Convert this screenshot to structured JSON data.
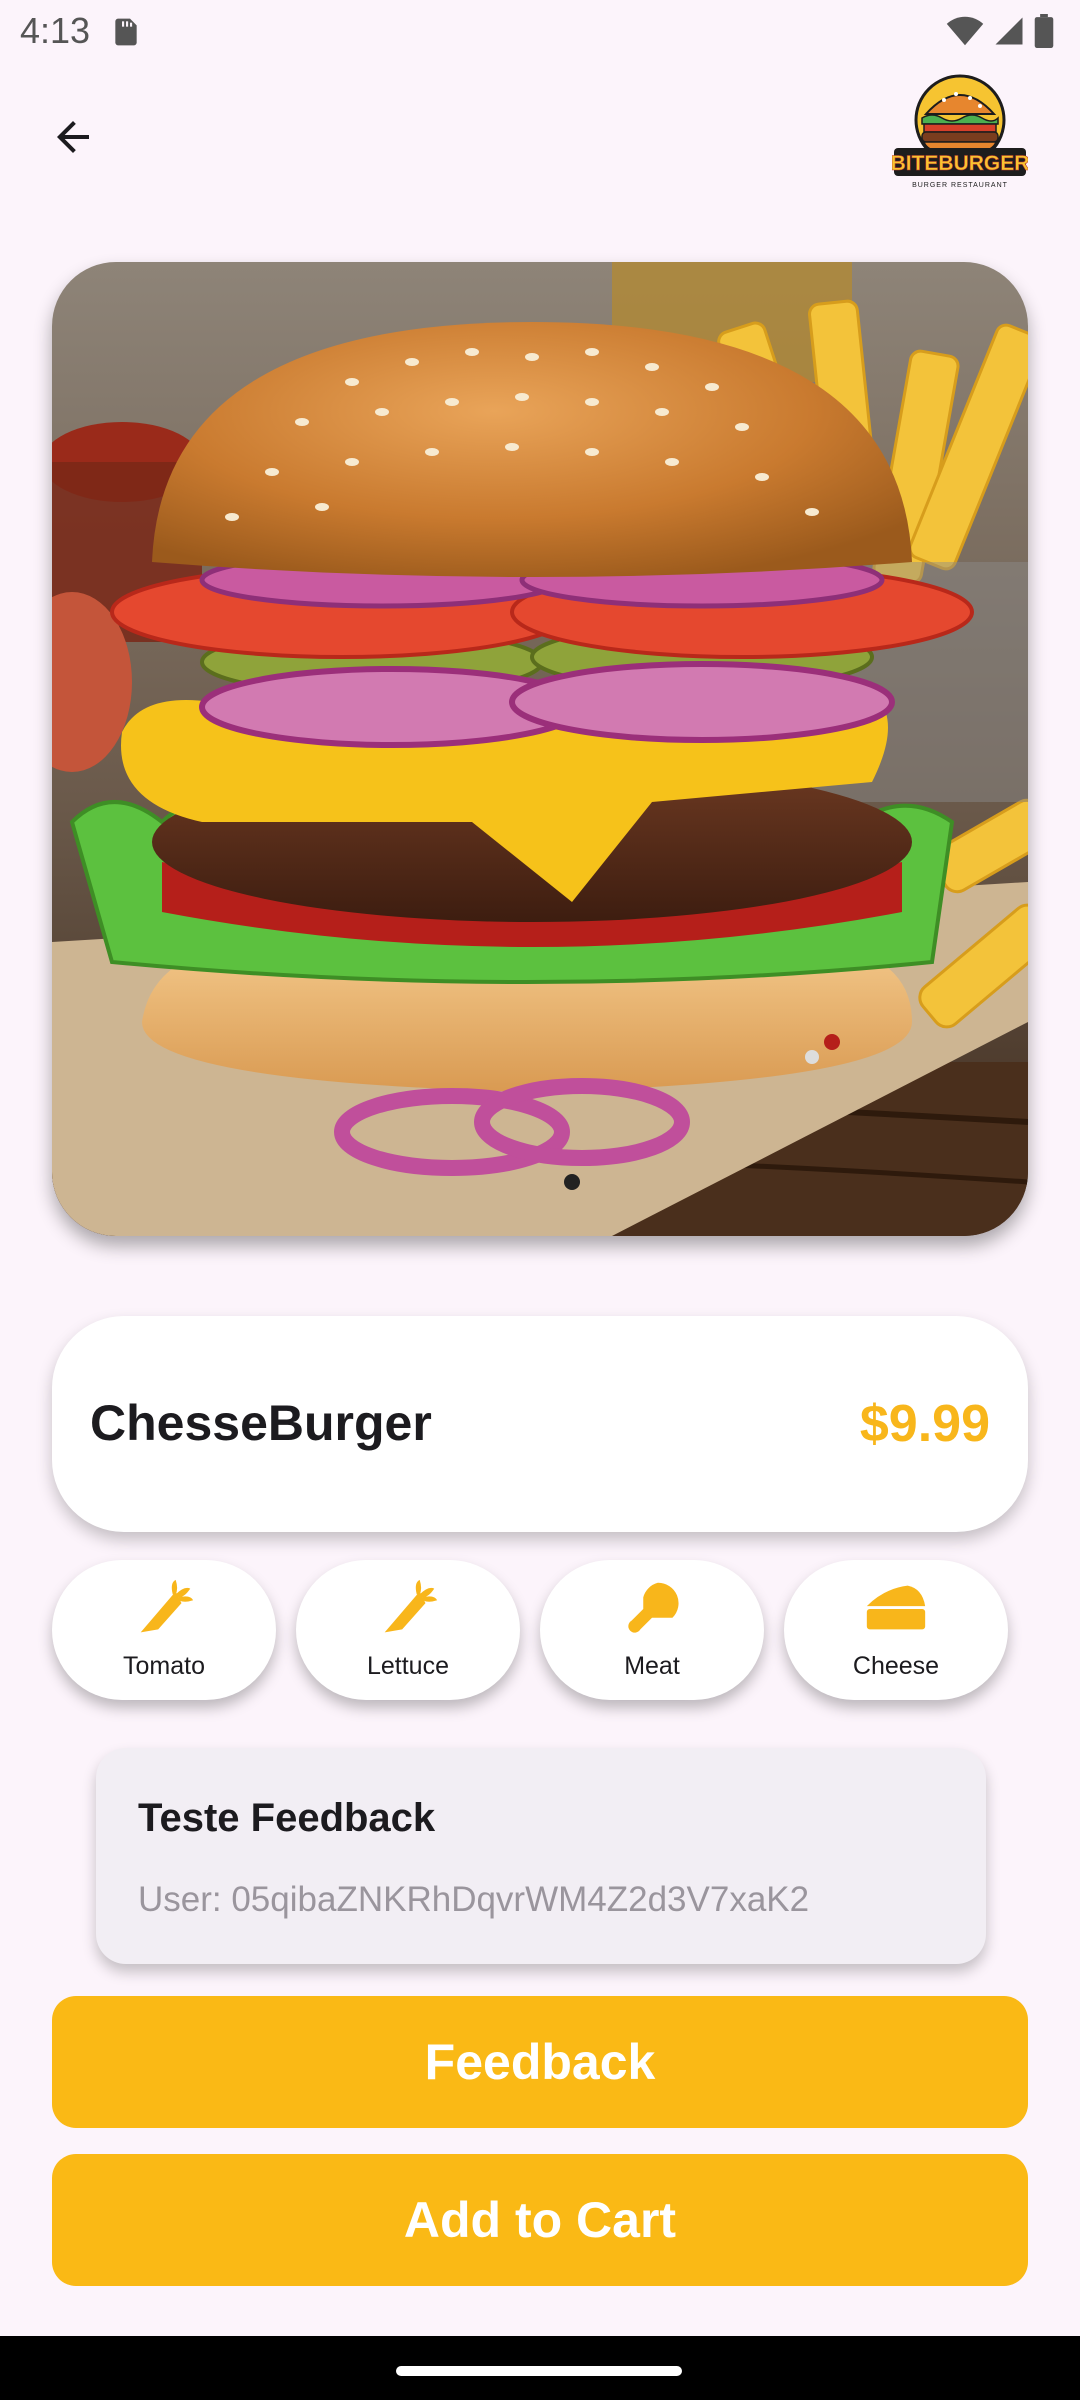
{
  "status_bar": {
    "time": "4:13"
  },
  "header": {
    "logo_text": "BITEBURGER",
    "logo_tagline": "BURGER RESTAURANT"
  },
  "product": {
    "name": "ChesseBurger",
    "price": "$9.99"
  },
  "ingredients": [
    {
      "label": "Tomato",
      "icon": "carrot-icon"
    },
    {
      "label": "Lettuce",
      "icon": "carrot-icon"
    },
    {
      "label": "Meat",
      "icon": "drumstick-icon"
    },
    {
      "label": "Cheese",
      "icon": "cheese-icon"
    }
  ],
  "feedback": {
    "title": "Teste Feedback",
    "user": "User: 05qibaZNKRhDqvrWM4Z2d3V7xaK2"
  },
  "buttons": {
    "feedback": "Feedback",
    "add_to_cart": "Add to Cart"
  },
  "colors": {
    "accent": "#fab915",
    "price": "#f8b61b",
    "background": "#fcf4fb"
  }
}
